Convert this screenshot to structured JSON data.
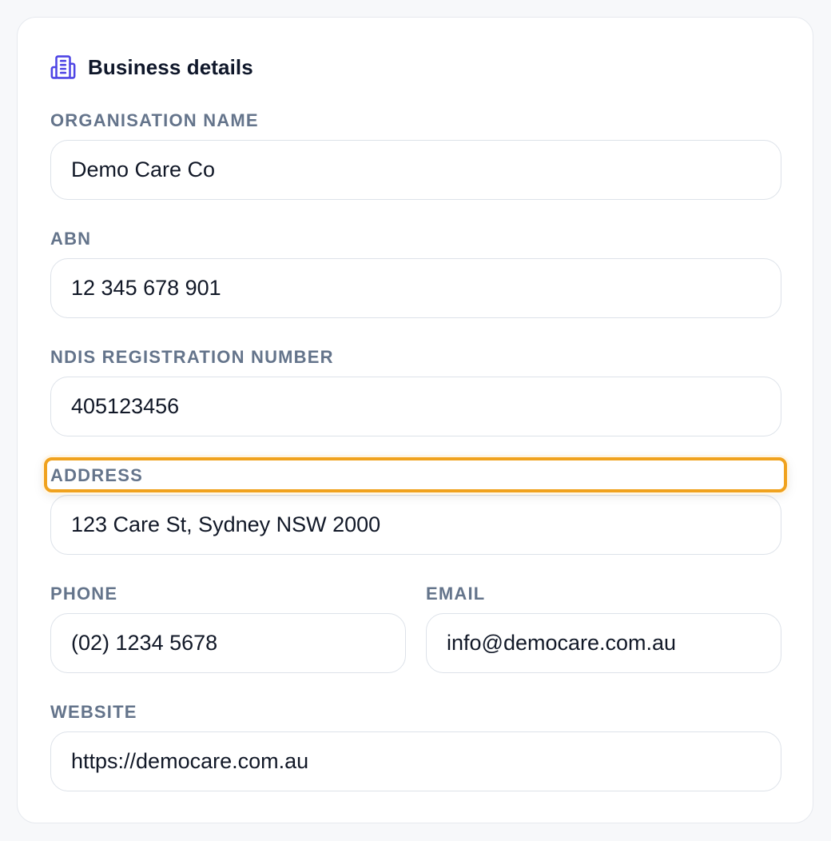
{
  "section": {
    "title": "Business details",
    "icon": "building-icon",
    "accent_color": "#4f46e5"
  },
  "fields": {
    "organisation_name": {
      "label": "ORGANISATION NAME",
      "value": "Demo Care Co"
    },
    "abn": {
      "label": "ABN",
      "value": "12 345 678 901"
    },
    "ndis_registration_number": {
      "label": "NDIS REGISTRATION NUMBER",
      "value": "405123456"
    },
    "address": {
      "label": "ADDRESS",
      "value": "123 Care St, Sydney NSW 2000"
    },
    "phone": {
      "label": "PHONE",
      "value": "(02) 1234 5678"
    },
    "email": {
      "label": "EMAIL",
      "value": "info@democare.com.au"
    },
    "website": {
      "label": "WEBSITE",
      "value": "https://democare.com.au"
    }
  },
  "highlight": {
    "target": "address-label",
    "color": "#f0a21e"
  }
}
